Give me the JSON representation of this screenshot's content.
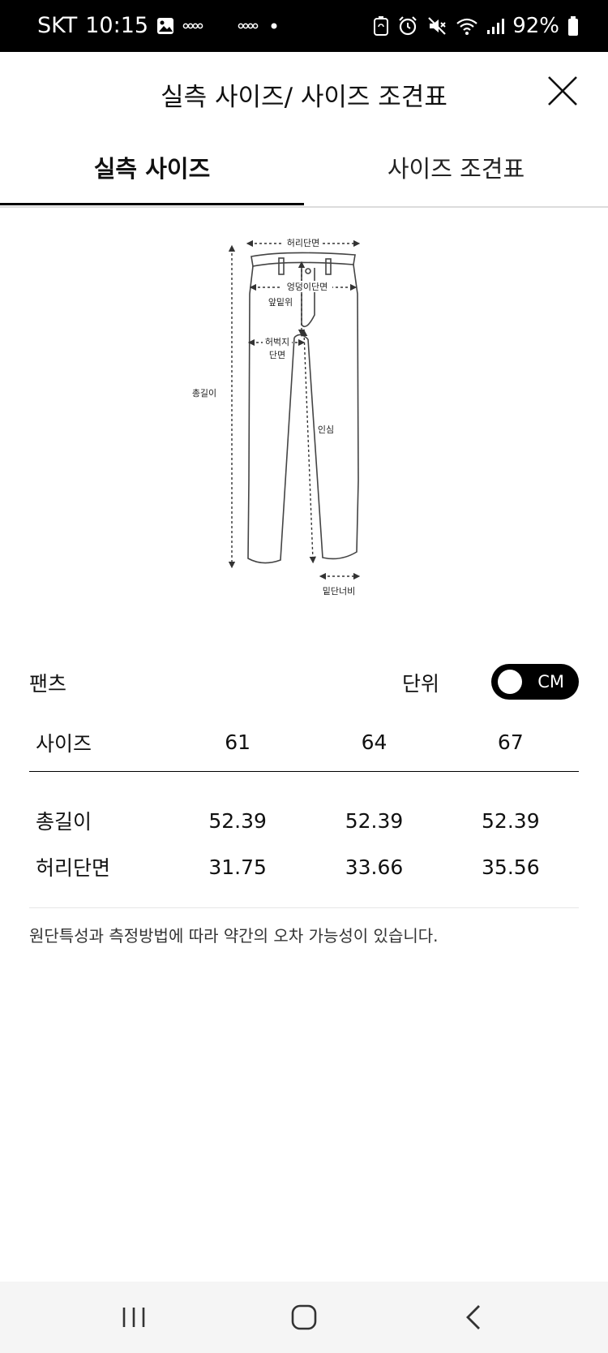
{
  "status_bar": {
    "carrier": "SKT",
    "time": "10:15",
    "battery": "92%"
  },
  "header": {
    "title": "실측 사이즈/ 사이즈 조견표"
  },
  "tabs": [
    {
      "label": "실측 사이즈",
      "active": true
    },
    {
      "label": "사이즈 조견표",
      "active": false
    }
  ],
  "diagram": {
    "waist": "허리단면",
    "hip": "엉덩이단면",
    "rise": "앞밑위",
    "thigh_line1": "허벅지",
    "thigh_line2": "단면",
    "length": "총길이",
    "inseam": "인심",
    "hem": "밑단너비"
  },
  "section": {
    "category": "팬츠",
    "unit_label": "단위",
    "unit_value": "CM"
  },
  "table": {
    "header": [
      "사이즈",
      "61",
      "64",
      "67"
    ],
    "rows": [
      {
        "label": "총길이",
        "values": [
          "52.39",
          "52.39",
          "52.39"
        ]
      },
      {
        "label": "허리단면",
        "values": [
          "31.75",
          "33.66",
          "35.56"
        ]
      }
    ]
  },
  "note": "원단특성과 측정방법에 따라 약간의 오차 가능성이 있습니다."
}
